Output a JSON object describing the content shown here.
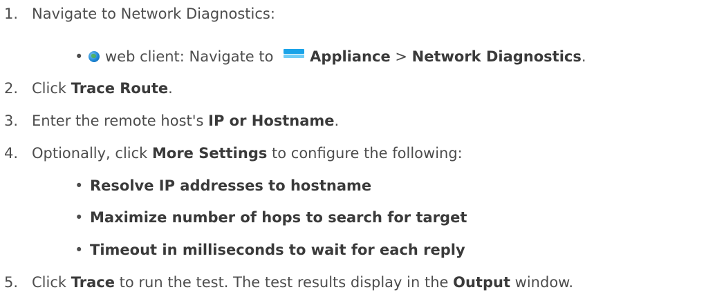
{
  "steps": [
    {
      "number": "1.",
      "text": "Navigate to Network Diagnostics:"
    },
    {
      "number": "2.",
      "pre": "Click ",
      "bold": "Trace Route",
      "post": "."
    },
    {
      "number": "3.",
      "pre": "Enter the remote host's ",
      "bold": "IP or Hostname",
      "post": "."
    },
    {
      "number": "4.",
      "pre": "Optionally, click ",
      "bold": "More Settings",
      "post": " to configure the following:"
    },
    {
      "number": "5.",
      "pre": "Click ",
      "bold": "Trace",
      "mid": " to run the test. The test results display in the ",
      "bold2": "Output",
      "post": " window."
    }
  ],
  "web_client": {
    "bullet": "•",
    "label": "web client: Navigate to ",
    "appliance": "Appliance",
    "separator": " > ",
    "network_diagnostics": "Network Diagnostics",
    "end": "."
  },
  "settings": [
    {
      "bullet": "•",
      "label": "Resolve IP addresses to hostname"
    },
    {
      "bullet": "•",
      "label": "Maximize number of hops to search for target"
    },
    {
      "bullet": "•",
      "label": "Timeout in milliseconds to wait for each reply"
    }
  ],
  "icons": {
    "globe": "globe-icon",
    "appliance": "appliance-icon"
  }
}
